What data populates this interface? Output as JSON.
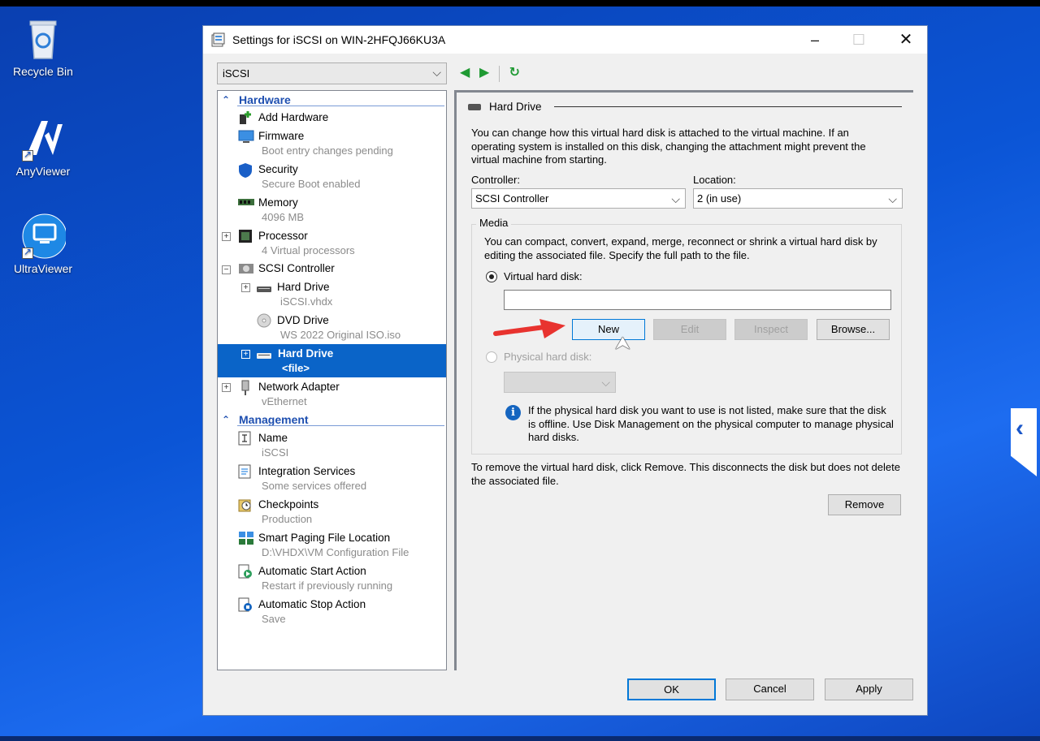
{
  "desktop": {
    "icons": [
      {
        "label": "Recycle Bin"
      },
      {
        "label": "AnyViewer"
      },
      {
        "label": "UltraViewer"
      }
    ]
  },
  "window": {
    "title": "Settings for iSCSI on WIN-2HFQJ66KU3A",
    "vm_select": "iSCSI"
  },
  "tree": {
    "hardware_header": "Hardware",
    "management_header": "Management",
    "hardware_items": [
      {
        "label": "Add Hardware",
        "sub": ""
      },
      {
        "label": "Firmware",
        "sub": "Boot entry changes pending"
      },
      {
        "label": "Security",
        "sub": "Secure Boot enabled"
      },
      {
        "label": "Memory",
        "sub": "4096 MB"
      },
      {
        "label": "Processor",
        "sub": "4 Virtual processors"
      },
      {
        "label": "SCSI Controller",
        "sub": ""
      },
      {
        "label": "Hard Drive",
        "sub": "iSCSI.vhdx"
      },
      {
        "label": "DVD Drive",
        "sub": "WS 2022 Original ISO.iso"
      },
      {
        "label": "Hard Drive",
        "sub": "<file>"
      },
      {
        "label": "Network Adapter",
        "sub": "vEthernet"
      }
    ],
    "management_items": [
      {
        "label": "Name",
        "sub": "iSCSI"
      },
      {
        "label": "Integration Services",
        "sub": "Some services offered"
      },
      {
        "label": "Checkpoints",
        "sub": "Production"
      },
      {
        "label": "Smart Paging File Location",
        "sub": "D:\\VHDX\\VM Configuration File"
      },
      {
        "label": "Automatic Start Action",
        "sub": "Restart if previously running"
      },
      {
        "label": "Automatic Stop Action",
        "sub": "Save"
      }
    ]
  },
  "panel": {
    "section_title": "Hard Drive",
    "description": "You can change how this virtual hard disk is attached to the virtual machine. If an operating system is installed on this disk, changing the attachment might prevent the virtual machine from starting.",
    "controller_label": "Controller:",
    "controller_value": "SCSI Controller",
    "location_label": "Location:",
    "location_value": "2 (in use)",
    "media_label": "Media",
    "media_desc": "You can compact, convert, expand, merge, reconnect or shrink a virtual hard disk by editing the associated file. Specify the full path to the file.",
    "vhd_radio_label": "Virtual hard disk:",
    "vhd_path_value": "",
    "btn_new": "New",
    "btn_edit": "Edit",
    "btn_inspect": "Inspect",
    "btn_browse": "Browse...",
    "phys_radio_label": "Physical hard disk:",
    "info_text": "If the physical hard disk you want to use is not listed, make sure that the disk is offline. Use Disk Management on the physical computer to manage physical hard disks.",
    "remove_text": "To remove the virtual hard disk, click Remove. This disconnects the disk but does not delete the associated file.",
    "btn_remove": "Remove"
  },
  "footer": {
    "ok": "OK",
    "cancel": "Cancel",
    "apply": "Apply"
  },
  "colors": {
    "selection": "#0a64c8",
    "section_header": "#1e4fb0",
    "annotation_arrow": "#e8332f"
  }
}
